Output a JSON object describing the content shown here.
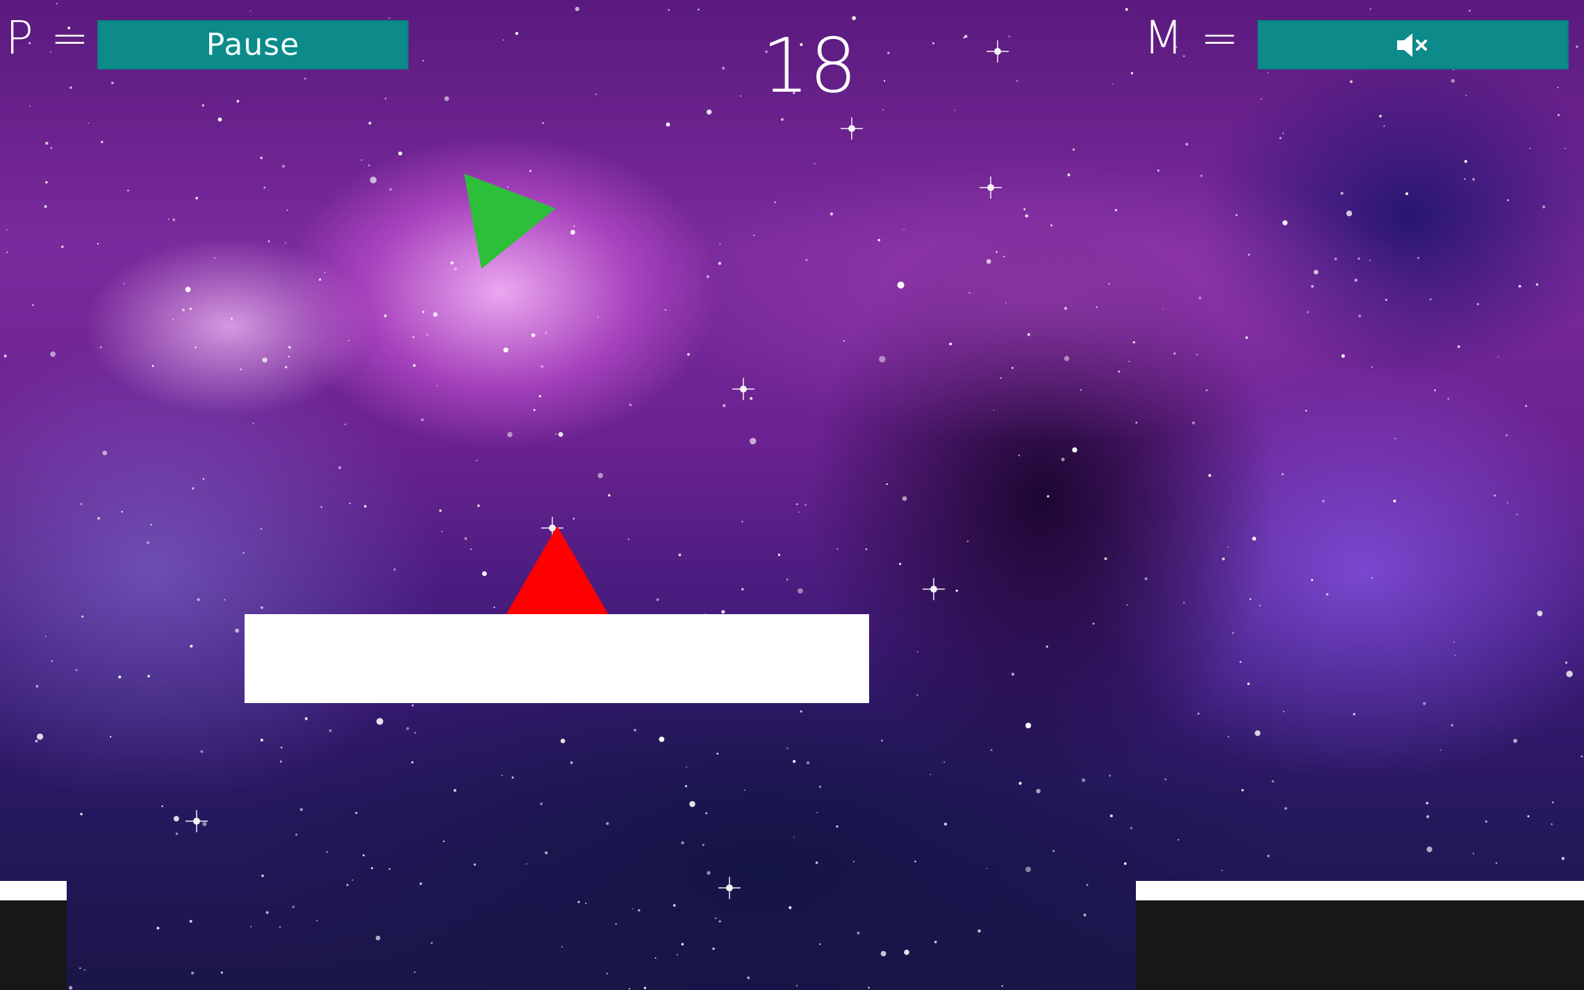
{
  "hud": {
    "pause_key": "P =",
    "pause_label": "Pause",
    "mute_key": "M =",
    "mute_icon": "speaker-muted-icon",
    "score": "18"
  },
  "colors": {
    "button_bg": "#0d8a8a",
    "player": "#2dbf3a",
    "spike": "#ff0000",
    "platform": "#ffffff",
    "ground": "#171717"
  },
  "sprites": {
    "player_icon": "green-triangle-ship",
    "hazard_icon": "red-triangle-spike"
  }
}
